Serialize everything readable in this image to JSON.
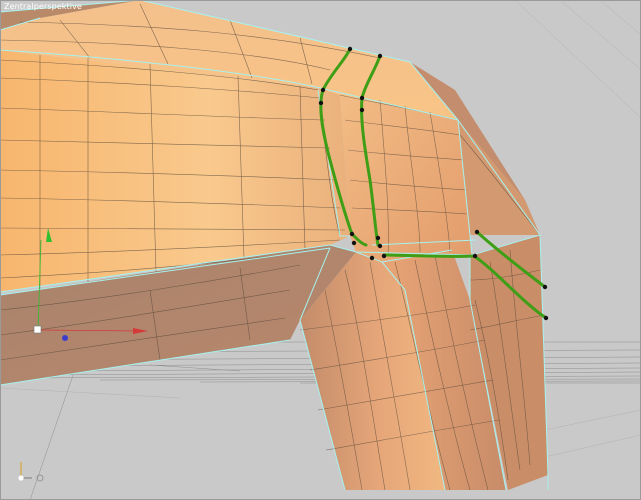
{
  "viewport": {
    "label": "Zentralperspektive",
    "background": "#c9c9c9",
    "colors": {
      "mesh_light": "#f8c486",
      "mesh_mid": "#e6a06a",
      "mesh_shadow": "#b27d62",
      "wire": "#5a4a3a",
      "selection_outline": "#a6f2f0",
      "edge_loop": "#3e9e16",
      "vertex": "#111111",
      "axis_x": "#d43a3a",
      "axis_y": "#2fbf2f",
      "axis_z": "#3c3ccc"
    },
    "scene": {
      "object": "bent-tube-mesh",
      "selected_edge_loops": 4,
      "axis_gizmo": [
        "x-axis",
        "y-axis",
        "z-axis"
      ],
      "ground_grid": "visible"
    }
  }
}
